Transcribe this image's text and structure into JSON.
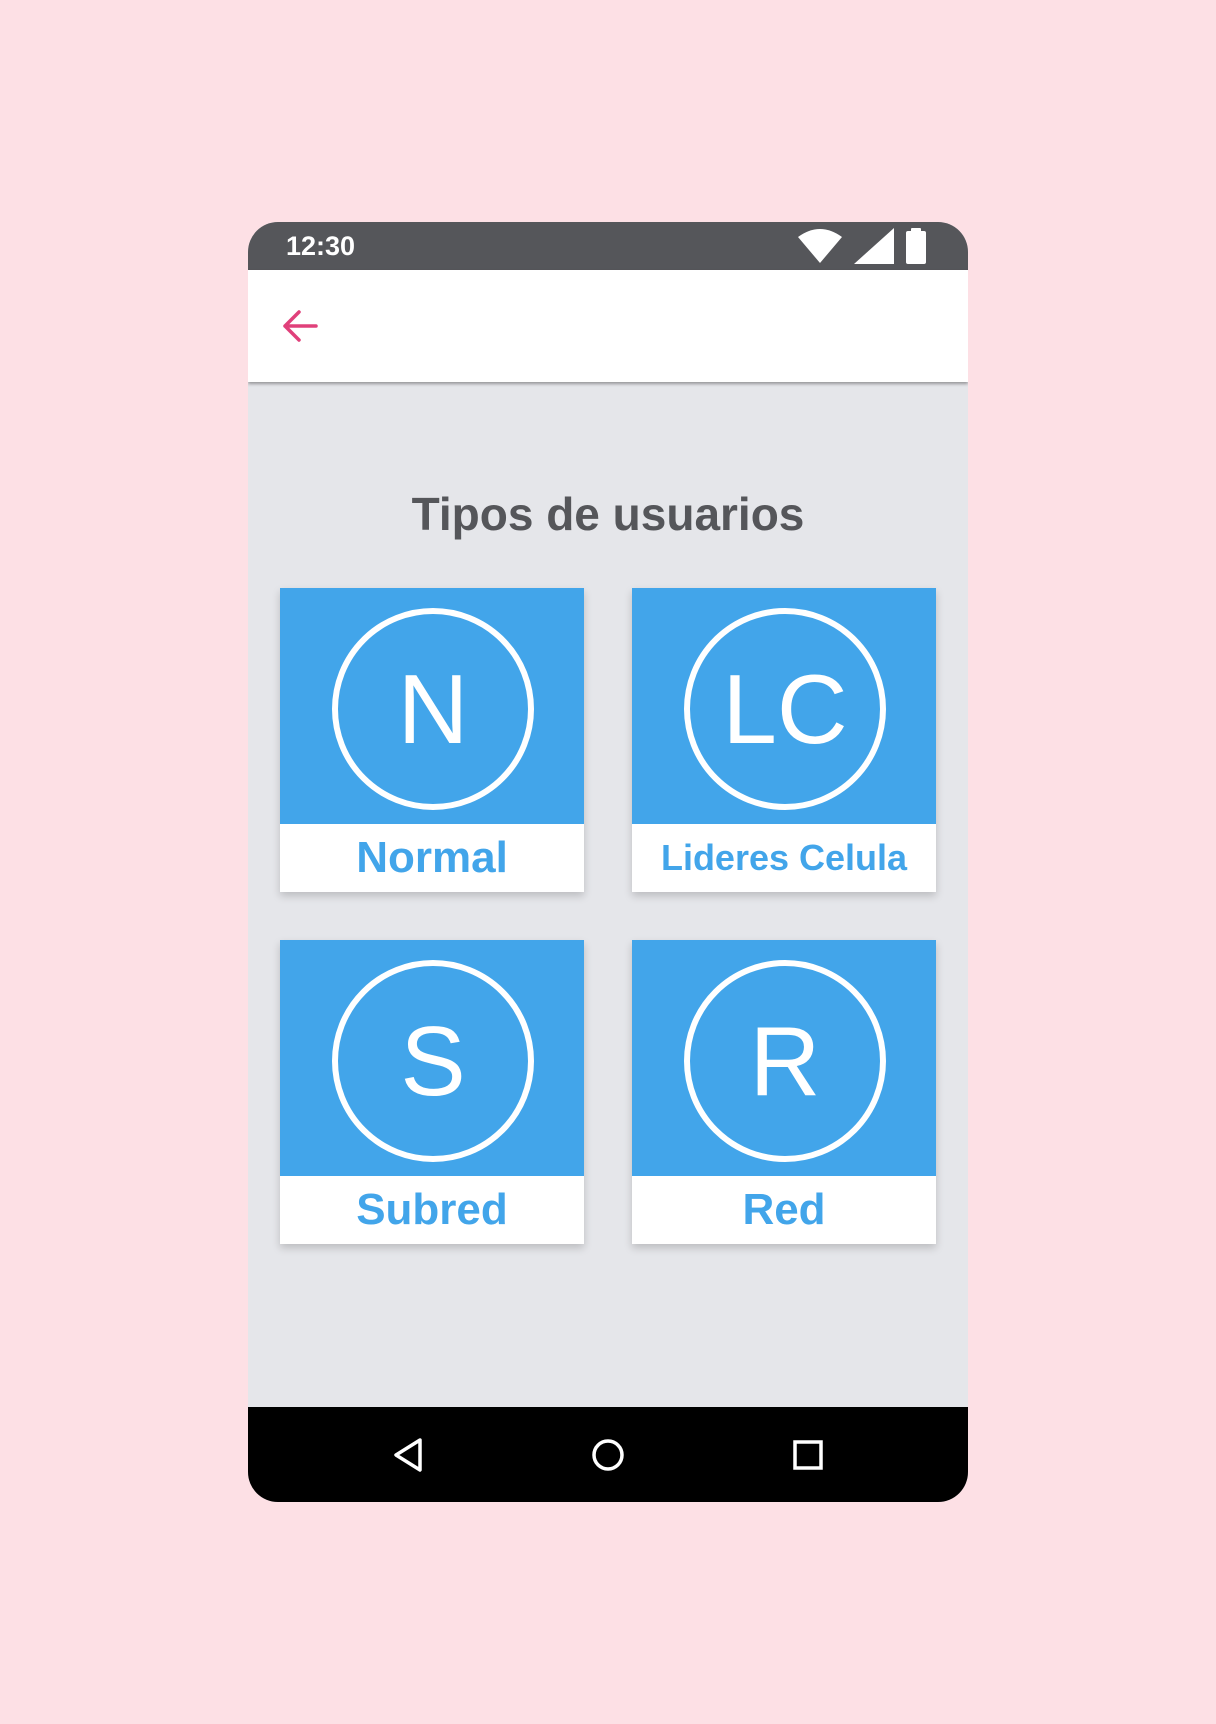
{
  "status_bar": {
    "time": "12:30",
    "icons": [
      "wifi-icon",
      "signal-icon",
      "battery-icon"
    ]
  },
  "app_bar": {
    "back_icon": "arrow-back-icon",
    "accent_color": "#e0407a"
  },
  "main": {
    "title": "Tipos de usuarios",
    "cards": [
      {
        "initials": "N",
        "label": "Normal"
      },
      {
        "initials": "LC",
        "label": "Lideres Celula"
      },
      {
        "initials": "S",
        "label": "Subred"
      },
      {
        "initials": "R",
        "label": "Red"
      }
    ]
  },
  "nav_bar": {
    "buttons": [
      "back-triangle-icon",
      "home-circle-icon",
      "recents-square-icon"
    ]
  },
  "colors": {
    "background": "#fde0e5",
    "status_bar": "#55565a",
    "card_blue": "#42a5ea",
    "content_bg": "#e5e6ea",
    "title_text": "#55565a",
    "nav_bar": "#000000"
  }
}
